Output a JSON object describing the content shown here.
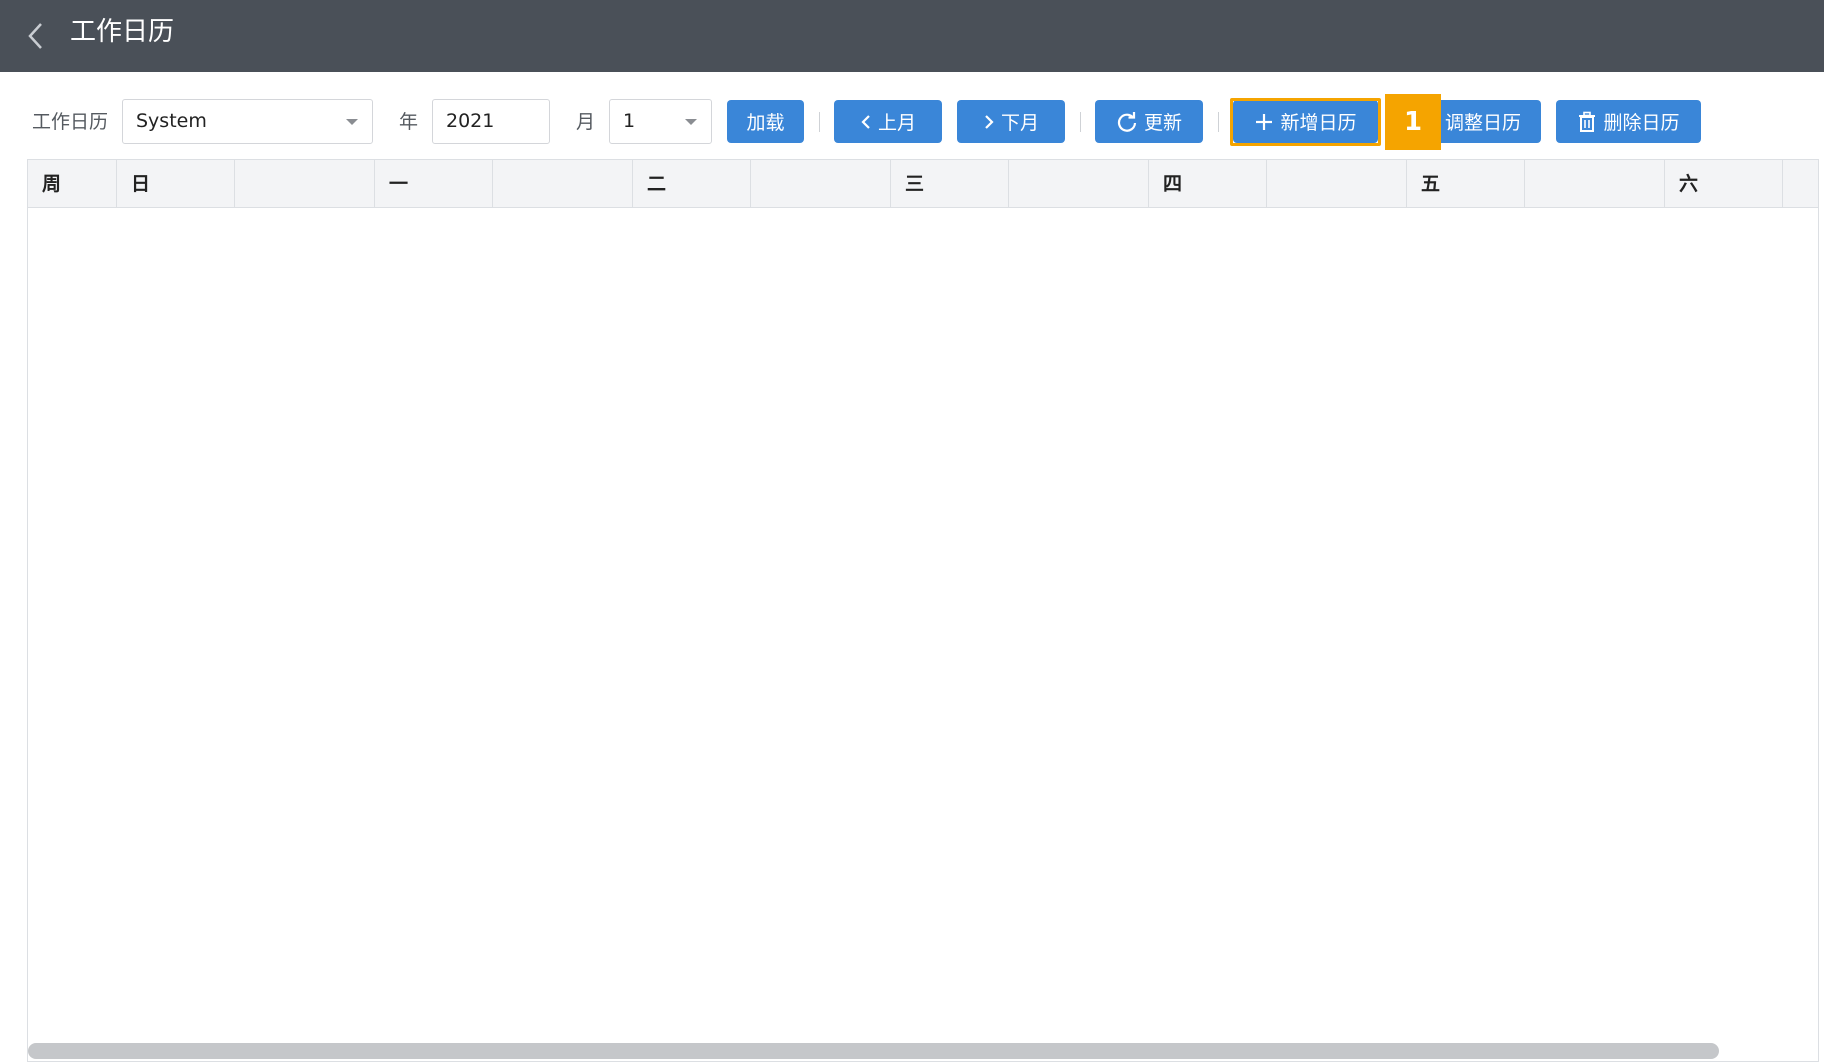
{
  "header": {
    "back_icon": "chevron-left-icon",
    "title": "工作日历"
  },
  "toolbar": {
    "calendar_label": "工作日历",
    "calendar_value": "System",
    "year_label": "年",
    "year_value": "2021",
    "month_label": "月",
    "month_value": "1",
    "load_label": "加载",
    "prev_month_label": "上月",
    "next_month_label": "下月",
    "refresh_label": "更新",
    "add_calendar_label": "新增日历",
    "adjust_calendar_label": "调整日历",
    "delete_calendar_label": "删除日历"
  },
  "step_badge": "1",
  "calendar": {
    "columns": [
      "周",
      "日",
      "",
      "一",
      "",
      "二",
      "",
      "三",
      "",
      "四",
      "",
      "五",
      "",
      "六",
      ""
    ]
  },
  "colors": {
    "header_bg": "#4a5058",
    "button_bg": "#3a86d8",
    "highlight": "#f5a400"
  }
}
